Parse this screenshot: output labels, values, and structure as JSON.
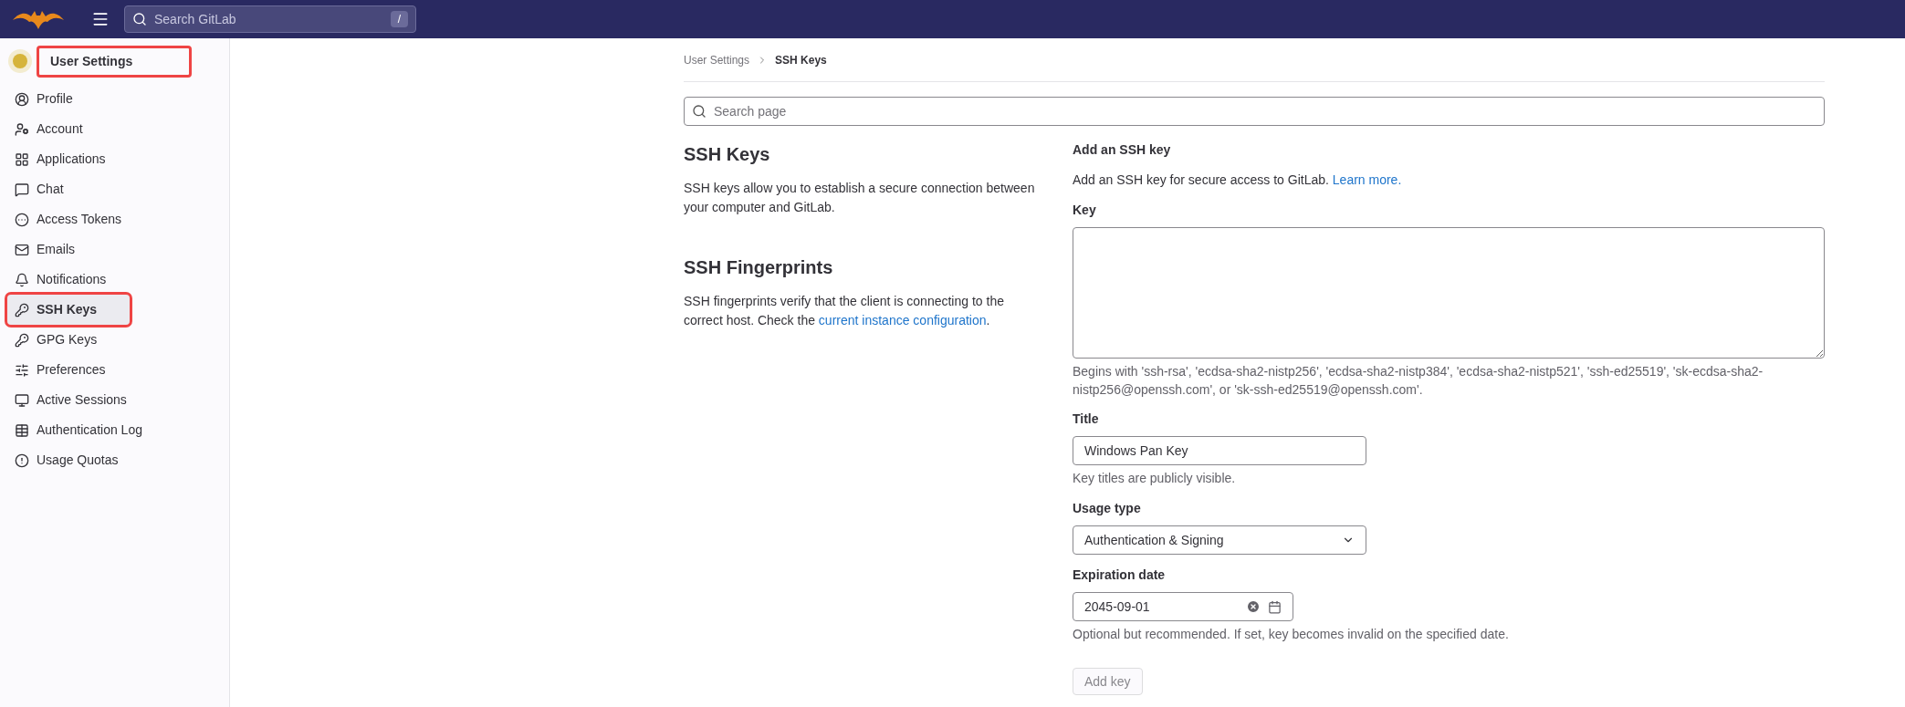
{
  "topbar": {
    "search": {
      "placeholder": "Search GitLab",
      "shortcut": "/"
    }
  },
  "sidebar": {
    "title": "User Settings",
    "title_annotated": true,
    "items": [
      {
        "label": "Profile",
        "selected": false,
        "annotated": false
      },
      {
        "label": "Account",
        "selected": false,
        "annotated": false
      },
      {
        "label": "Applications",
        "selected": false,
        "annotated": false
      },
      {
        "label": "Chat",
        "selected": false,
        "annotated": false
      },
      {
        "label": "Access Tokens",
        "selected": false,
        "annotated": false
      },
      {
        "label": "Emails",
        "selected": false,
        "annotated": false
      },
      {
        "label": "Notifications",
        "selected": false,
        "annotated": false
      },
      {
        "label": "SSH Keys",
        "selected": true,
        "annotated": true
      },
      {
        "label": "GPG Keys",
        "selected": false,
        "annotated": false
      },
      {
        "label": "Preferences",
        "selected": false,
        "annotated": false
      },
      {
        "label": "Active Sessions",
        "selected": false,
        "annotated": false
      },
      {
        "label": "Authentication Log",
        "selected": false,
        "annotated": false
      },
      {
        "label": "Usage Quotas",
        "selected": false,
        "annotated": false
      }
    ]
  },
  "breadcrumb": [
    "User Settings",
    "SSH Keys"
  ],
  "page_search": {
    "placeholder": "Search page"
  },
  "sections": [
    {
      "title": "SSH Keys",
      "text": "SSH keys allow you to establish a secure connection between your computer and GitLab."
    },
    {
      "title": "SSH Fingerprints",
      "text": "SSH fingerprints verify that the client is connecting to the correct host. Check the",
      "link": "current instance configuration",
      "after": "."
    }
  ],
  "form": {
    "heading": "Add an SSH key",
    "intro": "Add an SSH key for secure access to GitLab.",
    "intro_link": "Learn more.",
    "key_label": "Key",
    "key_hint": "Begins with 'ssh-rsa', 'ecdsa-sha2-nistp256', 'ecdsa-sha2-nistp384', 'ecdsa-sha2-nistp521', 'ssh-ed25519', 'sk-ecdsa-sha2-nistp256@openssh.com', or 'sk-ssh-ed25519@openssh.com'.",
    "title_label": "Title",
    "title_value": "Windows Pan Key",
    "title_hint": "Key titles are publicly visible.",
    "usage_label": "Usage type",
    "usage_value": "Authentication & Signing",
    "expiration_label": "Expiration date",
    "expiration_value": "2045-09-01",
    "expiration_hint": "Optional but recommended. If set, key becomes invalid on the specified date.",
    "submit": {
      "label": "Add key",
      "disabled": true
    }
  }
}
